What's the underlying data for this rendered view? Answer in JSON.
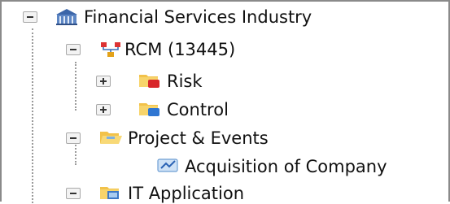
{
  "tree": {
    "root": {
      "label": "Financial Services Industry",
      "icon": "building-icon",
      "expanded": true
    },
    "rcm": {
      "label": "RCM (13445)",
      "icon": "hierarchy-icon",
      "expanded": true
    },
    "risk": {
      "label": "Risk",
      "icon": "folder-risk-icon",
      "expanded": false
    },
    "control": {
      "label": "Control",
      "icon": "folder-control-icon",
      "expanded": false
    },
    "projects": {
      "label": "Project & Events",
      "icon": "folder-open-icon",
      "expanded": true
    },
    "acquisition": {
      "label": "Acquisition of Company",
      "icon": "event-icon"
    },
    "it_app": {
      "label": "IT Application",
      "icon": "folder-app-icon",
      "expanded": true
    }
  }
}
